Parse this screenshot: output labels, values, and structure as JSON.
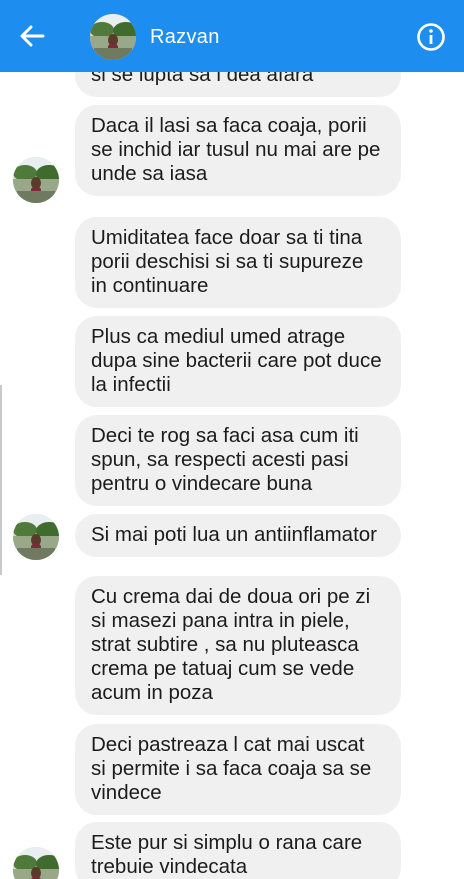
{
  "header": {
    "contact_name": "Razvan",
    "back_icon": "arrow-left-icon",
    "info_icon": "info-circle-icon",
    "bar_color": "#1d8ef0"
  },
  "messages": [
    {
      "text": "si se lupta sa l dea afara"
    },
    {
      "text": "Daca il lasi sa faca coaja, porii\nse inchid iar tusul nu mai are pe\nunde sa iasa"
    },
    {
      "text": "Umiditatea face doar sa ti tina\nporii deschisi si sa ti supureze\nin continuare"
    },
    {
      "text": "Plus ca mediul umed atrage\ndupa sine bacterii care pot duce\nla infectii"
    },
    {
      "text": "Deci te rog sa faci asa cum iti\nspun, sa respecti acesti pasi\npentru o vindecare buna"
    },
    {
      "text": "Si mai poti lua un antiinflamator"
    },
    {
      "text": "Cu crema dai de doua ori pe zi\nsi masezi pana intra in piele,\nstrat subtire , sa nu pluteasca\ncrema pe tatuaj cum se vede\nacum in poza"
    },
    {
      "text": "Deci pastreaza l cat mai uscat\nsi permite i sa faca coaja sa se\nvindece"
    },
    {
      "text": "Este pur si simplu o rana care\ntrebuie vindecata"
    }
  ],
  "colors": {
    "bubble": "#f1f0f0",
    "text": "#1c1c1c",
    "background": "#ffffff"
  }
}
